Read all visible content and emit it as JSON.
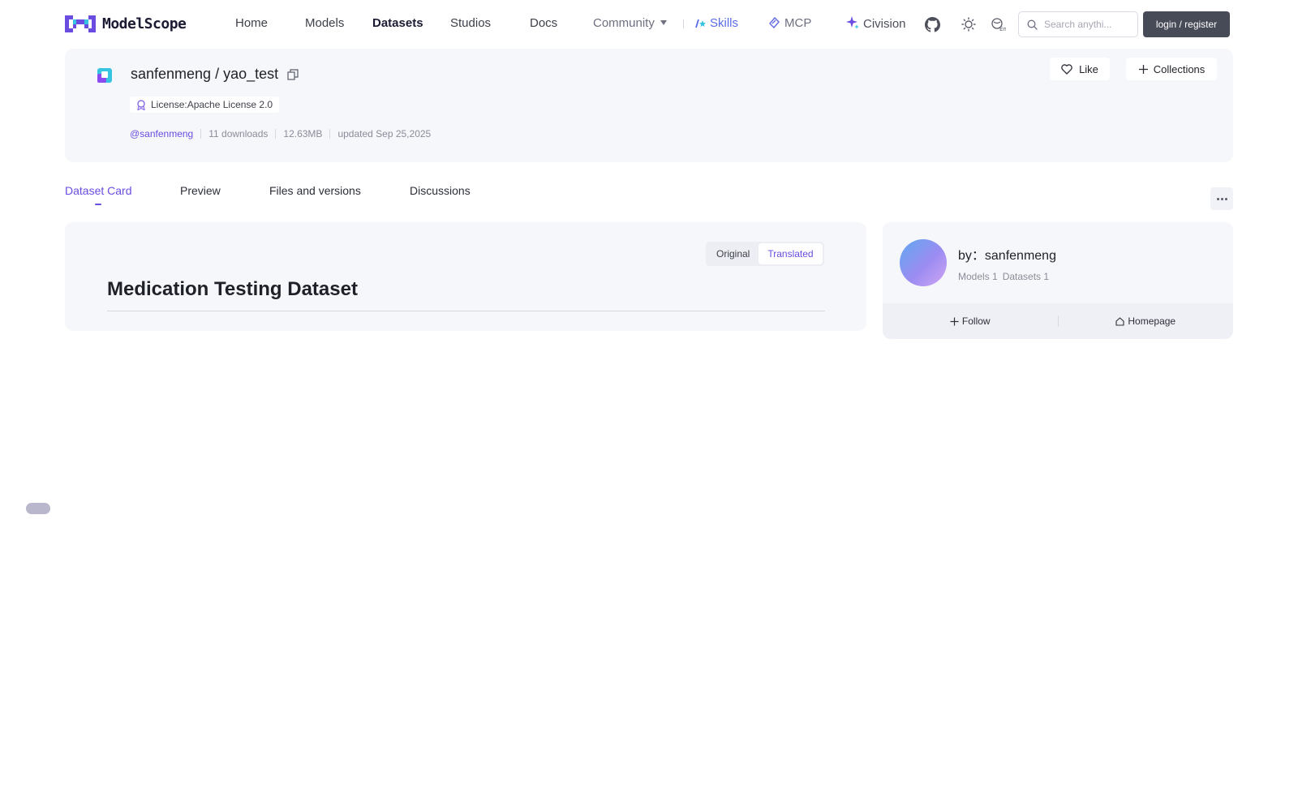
{
  "nav": {
    "logo_text": "ModelScope",
    "home": "Home",
    "models": "Models",
    "datasets": "Datasets",
    "studios": "Studios",
    "docs": "Docs",
    "community": "Community",
    "skills": "Skills",
    "mcp": "MCP",
    "civision": "Civision",
    "search_placeholder": "Search anythi...",
    "login": "login / register"
  },
  "header": {
    "owner": "sanfenmeng",
    "separator": "/",
    "repo": "yao_test",
    "license": "License:Apache License 2.0",
    "author": "@sanfenmeng",
    "downloads": "11 downloads",
    "size": "12.63MB",
    "updated": "updated Sep 25,2025",
    "like": "Like",
    "collections": "Collections"
  },
  "tabs": {
    "card": "Dataset Card",
    "preview": "Preview",
    "files": "Files and versions",
    "discussions": "Discussions"
  },
  "content": {
    "toggle_original": "Original",
    "toggle_translated": "Translated",
    "title": "Medication Testing Dataset"
  },
  "author_card": {
    "by": "by：sanfenmeng",
    "models": "Models 1",
    "datasets": "Datasets 1",
    "follow": "Follow",
    "homepage": "Homepage"
  },
  "colors": {
    "accent": "#6a4ce0",
    "skills": "#5a6be8",
    "login_bg": "#474a57",
    "card_bg": "#f6f7fb"
  },
  "icons": [
    "modelscope-logo-icon",
    "chevron-down-icon",
    "skills-icon",
    "mcp-icon",
    "civision-sparkle-icon",
    "github-icon",
    "theme-sun-icon",
    "language-icon",
    "search-icon",
    "dataset-icon",
    "copy-icon",
    "license-badge-icon",
    "heart-icon",
    "plus-icon",
    "more-icon",
    "home-icon"
  ]
}
